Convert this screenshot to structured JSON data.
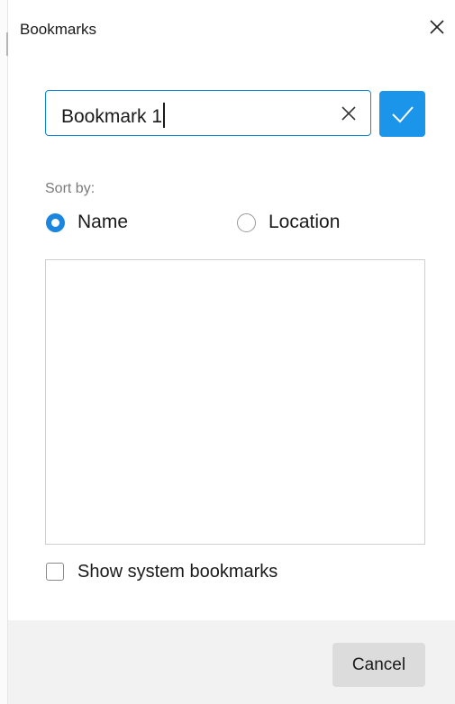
{
  "dialog": {
    "title": "Bookmarks",
    "close_icon": "close-icon"
  },
  "name_field": {
    "value": "Bookmark 1",
    "clear_icon": "clear-icon"
  },
  "confirm_button": {
    "icon": "checkmark-icon",
    "color": "#1b95ea"
  },
  "sort": {
    "label": "Sort by:",
    "options": [
      {
        "label": "Name",
        "selected": true
      },
      {
        "label": "Location",
        "selected": false
      }
    ]
  },
  "bookmarks_list": {
    "items": []
  },
  "show_system": {
    "label": "Show system bookmarks",
    "checked": false
  },
  "footer": {
    "cancel_label": "Cancel"
  },
  "colors": {
    "accent": "#1b86e0",
    "input_border": "#0f86d8",
    "footer_bg": "#f2f2f2"
  }
}
